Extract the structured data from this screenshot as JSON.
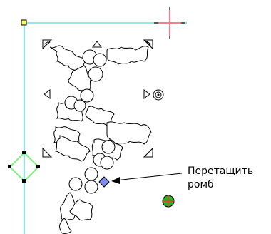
{
  "annotation": {
    "line1": "Перетащить",
    "line2": "ромб"
  },
  "colors": {
    "guide": "#5fe6e6",
    "crosshair_red": "#ff7a8a",
    "diamond": "#7f8cf0",
    "handle_diamond": "#7ef07e",
    "origin_square": "#ffff60",
    "artwork_stroke": "#000000"
  },
  "icons": {
    "origin": "yellow-square-origin-icon",
    "crosshair": "red-crosshair-icon",
    "rotate_handle": "concentric-circle-icon",
    "move_handle": "green-circle-crosshair-icon",
    "drag_diamond": "blue-diamond-icon"
  }
}
